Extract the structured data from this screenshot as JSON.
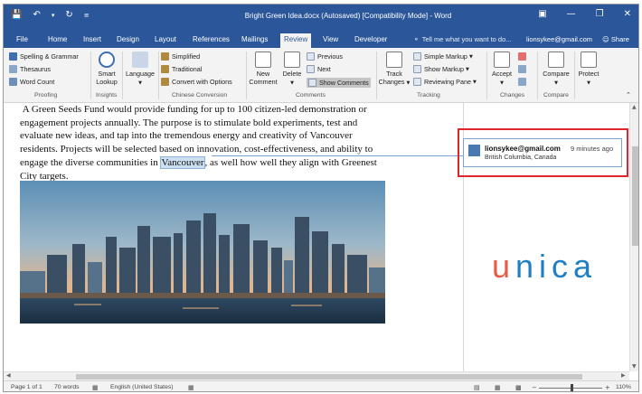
{
  "window": {
    "title": "Bright Green Idea.docx (Autosaved) [Compatibility Mode] - Word"
  },
  "tabs": [
    "File",
    "Home",
    "Insert",
    "Design",
    "Layout",
    "References",
    "Mailings",
    "Review",
    "View",
    "Developer"
  ],
  "active_tab": "Review",
  "tell_me": "Tell me what you want to do...",
  "account": "lionsykee@gmail.com",
  "share": "Share",
  "ribbon": {
    "proofing": {
      "spelling": "Spelling & Grammar",
      "thesaurus": "Thesaurus",
      "word_count": "Word Count",
      "label": "Proofing"
    },
    "insights": {
      "smart_lookup_1": "Smart",
      "smart_lookup_2": "Lookup",
      "label": "Insights"
    },
    "language": {
      "label_btn": "Language"
    },
    "chinese": {
      "simplified": "Simplified",
      "traditional": "Traditional",
      "convert": "Convert with Options",
      "label": "Chinese Conversion"
    },
    "comments": {
      "new_1": "New",
      "new_2": "Comment",
      "delete": "Delete",
      "previous": "Previous",
      "next": "Next",
      "show": "Show Comments",
      "label": "Comments"
    },
    "tracking": {
      "track_1": "Track",
      "track_2": "Changes",
      "simple_markup": "Simple Markup",
      "show_markup": "Show Markup",
      "reviewing_pane": "Reviewing Pane",
      "label": "Tracking"
    },
    "changes": {
      "accept": "Accept",
      "label": "Changes"
    },
    "compare": {
      "compare": "Compare",
      "label": "Compare"
    },
    "protect": {
      "protect": "Protect"
    }
  },
  "document": {
    "text_before": "A Green Seeds Fund would provide funding for up to 100 citizen-led demonstration or engagement projects annually. The purpose is to stimulate bold experiments, test and evaluate new ideas, and tap into the tremendous energy and creativity of Vancouver residents. Projects will be selected based on innovation, cost-effectiveness, and ability to engage the diverse communities in ",
    "highlighted": "Vancouver",
    "text_after": ", as well how well they align with Greenest City targets."
  },
  "comment": {
    "author": "lionsykee@gmail.com",
    "time": "9 minutes ago",
    "text": "British Columbia,  Canada"
  },
  "watermark": "unica",
  "status": {
    "page": "Page 1 of 1",
    "words": "70 words",
    "language": "English (United States)",
    "zoom": "110%"
  },
  "colors": {
    "word_blue": "#2b579a",
    "comment_border": "#7aa3cf",
    "highlight_box": "#e0262c",
    "logo_u": "#e85c45",
    "logo_rest": "#1f7fc2"
  }
}
